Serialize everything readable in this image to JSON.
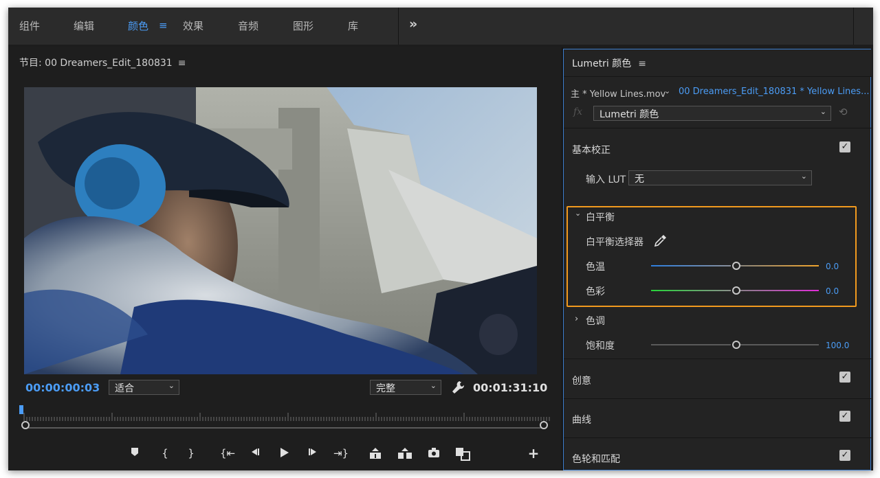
{
  "workspaces": {
    "tabs": [
      {
        "label": "组件",
        "active": false
      },
      {
        "label": "编辑",
        "active": false
      },
      {
        "label": "颜色",
        "active": true
      },
      {
        "label": "效果",
        "active": false
      },
      {
        "label": "音频",
        "active": false
      },
      {
        "label": "图形",
        "active": false
      },
      {
        "label": "库",
        "active": false
      }
    ],
    "menu_icon": "≡",
    "overflow_icon": "»"
  },
  "program": {
    "title": "节目: 00 Dreamers_Edit_180831",
    "menu_icon": "≡",
    "current_timecode": "00:00:00:03",
    "zoom_select": "适合",
    "resolution_select": "完整",
    "duration_timecode": "00:01:31:10",
    "wrench_icon": "wrench-icon",
    "transport": [
      {
        "name": "add-marker-icon",
        "glyph": "⬟"
      },
      {
        "name": "mark-in-icon",
        "glyph": "{"
      },
      {
        "name": "mark-out-icon",
        "glyph": "}"
      },
      {
        "name": "go-to-in-icon",
        "glyph": "{⇤"
      },
      {
        "name": "step-back-icon",
        "glyph": "◀|"
      },
      {
        "name": "play-icon",
        "glyph": "▶"
      },
      {
        "name": "step-forward-icon",
        "glyph": "|▶"
      },
      {
        "name": "go-to-out-icon",
        "glyph": "⇥}"
      },
      {
        "name": "lift-icon",
        "glyph": "▲"
      },
      {
        "name": "extract-icon",
        "glyph": "▲"
      },
      {
        "name": "export-frame-icon",
        "glyph": "◉"
      },
      {
        "name": "compare-view-icon",
        "glyph": "▣"
      }
    ],
    "add_button_glyph": "+"
  },
  "lumetri": {
    "title": "Lumetri 颜色",
    "menu_icon": "≡",
    "master_clip": "主 * Yellow Lines.mov",
    "sequence_clip": "00 Dreamers_Edit_180831 * Yellow Lines...",
    "fx_label": "fx",
    "effect_select": "Lumetri 颜色",
    "basic": {
      "title": "基本校正",
      "checked": true,
      "input_lut_label": "输入 LUT",
      "input_lut_value": "无",
      "white_balance": {
        "title": "白平衡",
        "expanded": true,
        "selector_label": "白平衡选择器",
        "temperature_label": "色温",
        "temperature_value": "0.0",
        "tint_label": "色彩",
        "tint_value": "0.0"
      },
      "tone": {
        "title": "色调",
        "expanded": false
      },
      "saturation_label": "饱和度",
      "saturation_value": "100.0"
    },
    "sections": [
      {
        "title": "创意",
        "checked": true
      },
      {
        "title": "曲线",
        "checked": true
      },
      {
        "title": "色轮和匹配",
        "checked": true
      }
    ],
    "colors": {
      "accent": "#4b9cf5",
      "highlight": "#f29a1e"
    }
  }
}
